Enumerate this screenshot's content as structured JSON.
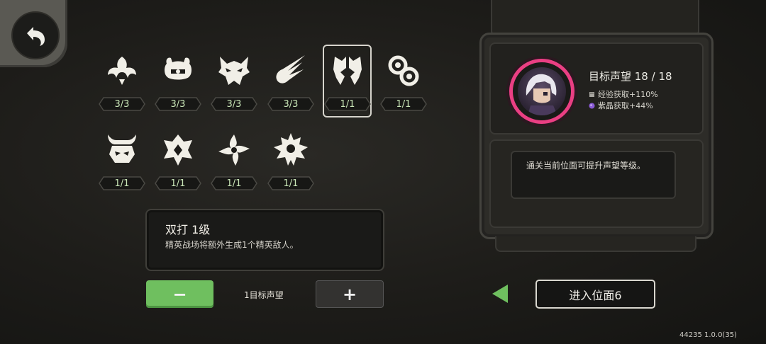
{
  "affixes": [
    {
      "icon": "wings-emblem-icon",
      "count": "3/3"
    },
    {
      "icon": "crab-eye-icon",
      "count": "3/3"
    },
    {
      "icon": "demon-mask-icon",
      "count": "3/3"
    },
    {
      "icon": "comet-icon",
      "count": "3/3"
    },
    {
      "icon": "twin-fist-icon",
      "count": "1/1",
      "selected": true
    },
    {
      "icon": "orb-cluster-icon",
      "count": "1/1"
    },
    {
      "icon": "horned-skull-icon",
      "count": "1/1"
    },
    {
      "icon": "flame-crest-icon",
      "count": "1/1"
    },
    {
      "icon": "shuriken-icon",
      "count": "1/1"
    },
    {
      "icon": "spiked-gear-icon",
      "count": "1/1"
    }
  ],
  "description": {
    "title": "双打 1级",
    "body": "精英战场将额外生成1个精英敌人。"
  },
  "controls": {
    "minus_label": "−",
    "plus_label": "+",
    "reputation_cost": "1目标声望"
  },
  "reputation_panel": {
    "title": "目标声望 18 / 18",
    "bonuses": [
      {
        "icon": "book-icon",
        "text": "经验获取+110%"
      },
      {
        "icon": "crystal-icon",
        "text": "紫晶获取+44%"
      }
    ],
    "hint": "通关当前位面可提升声望等级。"
  },
  "enter_button": "进入位面6",
  "version": "44235 1.0.0(35)",
  "colors": {
    "accent_green": "#6fbf5f",
    "avatar_ring": "#ea3f83",
    "count_text": "#c9e6b7"
  }
}
